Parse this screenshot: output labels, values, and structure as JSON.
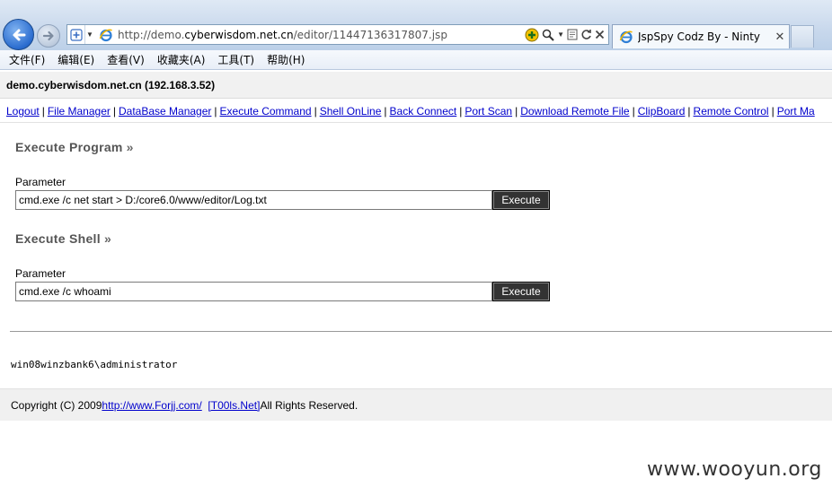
{
  "browser": {
    "url_prefix": "http://demo.",
    "url_domain": "cyberwisdom.net.cn",
    "url_path": "/editor/11447136317807.jsp",
    "tab_title": "JspSpy Codz By - Ninty",
    "icons": [
      "back-arrow-icon",
      "forward-arrow-icon",
      "compatibility-icon",
      "ie-icon",
      "search-icon",
      "refresh-icon",
      "stop-icon",
      "close-icon"
    ]
  },
  "menu": {
    "items": [
      "文件(F)",
      "编辑(E)",
      "查看(V)",
      "收藏夹(A)",
      "工具(T)",
      "帮助(H)"
    ]
  },
  "header": {
    "host": "demo.cyberwisdom.net.cn (192.168.3.52)"
  },
  "nav": {
    "links": [
      "Logout",
      "File Manager",
      "DataBase Manager",
      "Execute Command",
      "Shell OnLine",
      "Back Connect",
      "Port Scan",
      "Download Remote File",
      "ClipBoard",
      "Remote Control",
      "Port Ma"
    ],
    "separator": "|"
  },
  "exec_program": {
    "title": "Execute Program",
    "raquo": "»",
    "param_label": "Parameter",
    "value": "cmd.exe /c net start > D:/core6.0/www/editor/Log.txt",
    "button": "Execute"
  },
  "exec_shell": {
    "title": "Execute Shell",
    "raquo": "»",
    "param_label": "Parameter",
    "value": "cmd.exe /c whoami",
    "button": "Execute"
  },
  "output": "win08winzbank6\\administrator",
  "footer": {
    "prefix": "Copyright (C) 2009 ",
    "link1": "http://www.Forjj.com/",
    "link2": "[T00ls.Net]",
    "suffix": " All Rights Reserved."
  },
  "watermark": "www.wooyun.org",
  "colors": {
    "link": "#0000cc",
    "button_bg": "#333333",
    "title_gray": "#555555"
  }
}
